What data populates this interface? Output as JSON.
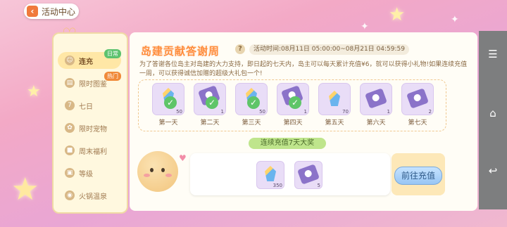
{
  "header": {
    "back_label": "活动中心"
  },
  "sidebar": {
    "items": [
      {
        "label": "连充",
        "tag": "日常"
      },
      {
        "label": "限时图鉴",
        "tag": "热门"
      },
      {
        "label": "七日"
      },
      {
        "label": "限时宠物"
      },
      {
        "label": "周末福利"
      },
      {
        "label": "等级"
      },
      {
        "label": "火锅温泉"
      }
    ]
  },
  "event": {
    "title": "岛建贡献答谢周",
    "time_text": "活动时间:08月11日 05:00:00~08月21日 04:59:59",
    "description": "为了答谢各位岛主对岛建的大力支持，即日起的七天内，岛主可以每天累计充值¥6，就可以获得小礼物!如果连续充值一周，可以获得诚信加赠的超级大礼包一个!"
  },
  "days": [
    {
      "label": "第一天",
      "icon": "crystal",
      "count": "50",
      "claimed": true
    },
    {
      "label": "第二天",
      "icon": "fan",
      "count": "1",
      "claimed": true
    },
    {
      "label": "第三天",
      "icon": "crystal",
      "count": "50",
      "claimed": true
    },
    {
      "label": "第四天",
      "icon": "fan",
      "count": "1",
      "claimed": true
    },
    {
      "label": "第五天",
      "icon": "crystal",
      "count": "70",
      "claimed": false
    },
    {
      "label": "第六天",
      "icon": "fan",
      "count": "1",
      "claimed": false
    },
    {
      "label": "第七天",
      "icon": "fan",
      "count": "2",
      "claimed": false
    }
  ],
  "bonus": {
    "label": "连续充值7天大奖",
    "rewards": [
      {
        "icon": "crystal",
        "count": "350"
      },
      {
        "icon": "fan",
        "count": "5"
      }
    ],
    "button_label": "前往充值"
  },
  "colors": {
    "accent": "#ff8c3a",
    "claimed": "#5fc569"
  }
}
